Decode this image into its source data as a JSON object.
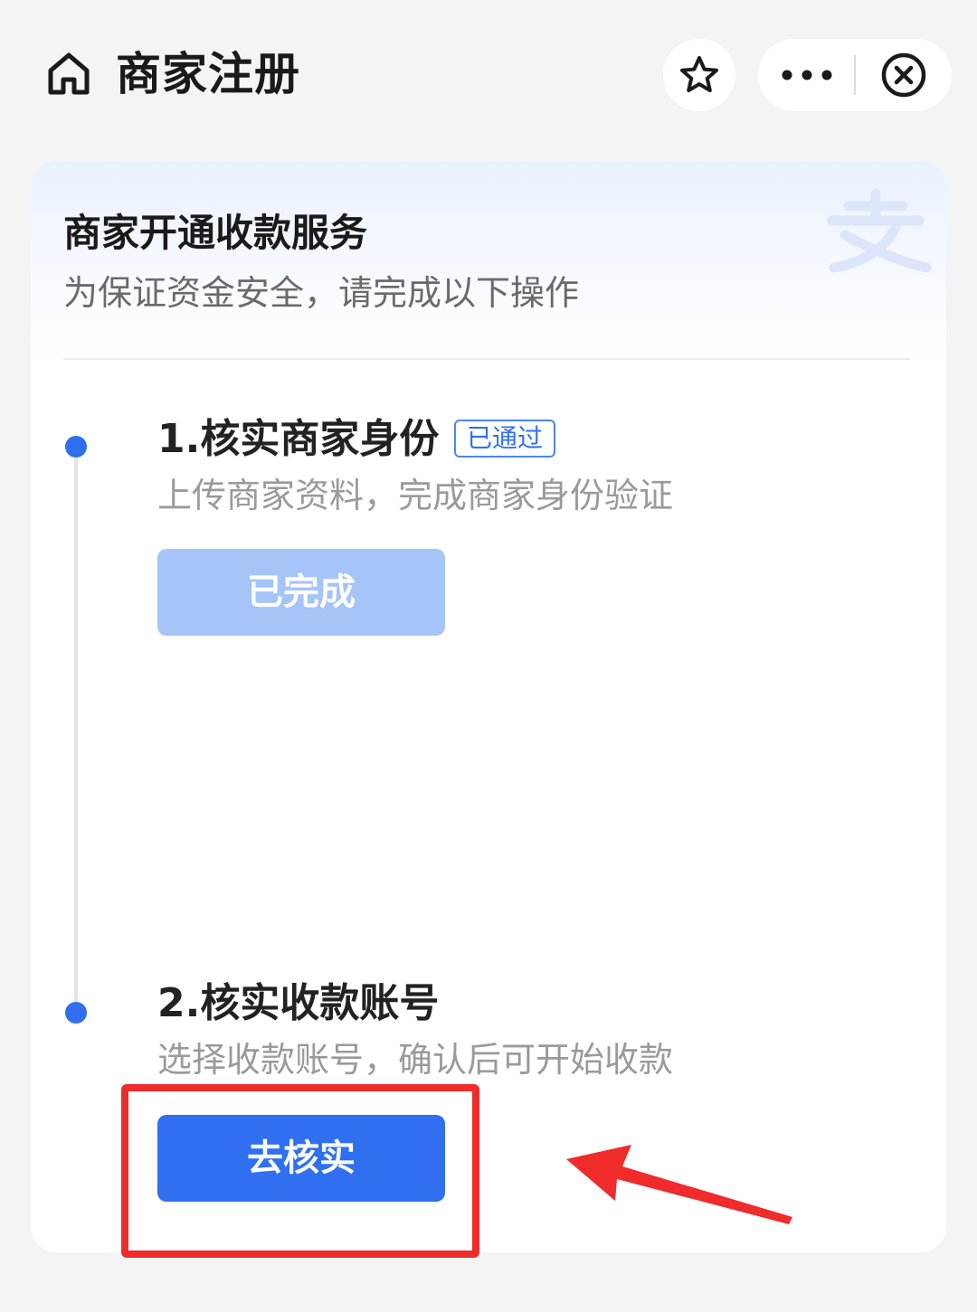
{
  "nav": {
    "title": "商家注册",
    "icons": {
      "home": "home-icon",
      "star": "star-icon",
      "more": "more-dots-icon",
      "close": "close-circle-icon"
    }
  },
  "card": {
    "title": "商家开通收款服务",
    "subtitle": "为保证资金安全，请完成以下操作",
    "watermark_icon": "alipay-logo-icon"
  },
  "steps": [
    {
      "title": "1.核实商家身份",
      "badge": "已通过",
      "description": "上传商家资料，完成商家身份验证",
      "button_label": "已完成",
      "button_state": "disabled"
    },
    {
      "title": "2.核实收款账号",
      "description": "选择收款账号，确认后可开始收款",
      "button_label": "去核实",
      "button_state": "active"
    }
  ],
  "annotation": {
    "color": "#ef2b2b",
    "target": "verify-button"
  },
  "colors": {
    "accent": "#2f6ff0",
    "accent_disabled": "#a5c4f8",
    "background": "#f4f4f5",
    "annotation": "#ef2b2b"
  }
}
